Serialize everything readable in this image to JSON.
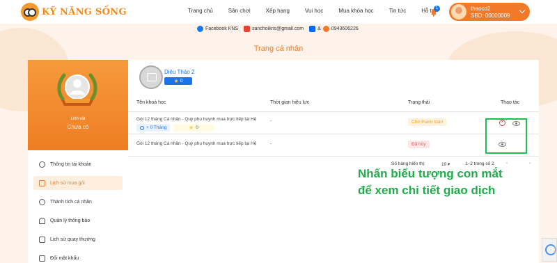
{
  "header": {
    "logo_text": "KỸ NĂNG SỐNG",
    "nav": [
      "Trang chủ",
      "Sân chơi",
      "Xếp hạng",
      "Vui học",
      "Mua khóa học",
      "Tin tức",
      "Hỗ trợ"
    ],
    "notification_count": "1",
    "user": {
      "name": "thaocd2",
      "sbd": "SBD: 00000009"
    }
  },
  "contacts": {
    "facebook": "Facebook KNS",
    "email": "sanchoikns@gmail.com",
    "amp": "&",
    "phone": "0943606226"
  },
  "page_title": "Trang cá nhân",
  "sidebar": {
    "rank_label": "Linh vật",
    "rank_value": "Chưa có",
    "menu": [
      {
        "label": "Thông tin tài khoản",
        "icon": "user-icon",
        "active": false
      },
      {
        "label": "Lịch sử mua gói",
        "icon": "cart-icon",
        "active": true
      },
      {
        "label": "Thành tích cá nhân",
        "icon": "medal-icon",
        "active": false
      },
      {
        "label": "Quản lý thông báo",
        "icon": "bell-icon",
        "active": false
      },
      {
        "label": "Lịch sử quay thưởng",
        "icon": "history-icon",
        "active": false
      },
      {
        "label": "Đổi mật khẩu",
        "icon": "lock-icon",
        "active": false
      }
    ]
  },
  "profile": {
    "name": "Diệu Thảo 2",
    "stars": "0"
  },
  "table": {
    "headers": [
      "Tên khoá học",
      "Thời gian hiệu lực",
      "Trạng thái",
      "Thao tác"
    ],
    "rows": [
      {
        "name": "Gói 12 tháng Cá nhân - Quý phụ huynh mua trực tiếp tại Hệ",
        "validity": "-",
        "status": "Chờ thanh toán",
        "months": "+ 0 Tháng",
        "stars": "0"
      },
      {
        "name": "Gói 12 tháng Cá nhân - Quý phụ huynh mua trực tiếp tại Hệ",
        "validity": "-",
        "status": "Đã hủy"
      }
    ]
  },
  "pagination": {
    "rows_label": "Số hàng hiển thị:",
    "rows_value": "10",
    "range": "1–2 trong số 2"
  },
  "annotation": {
    "line1": "Nhấn biểu tượng con mắt",
    "line2": "để xem chi tiết giao dịch"
  },
  "colors": {
    "accent": "#f07a2a",
    "link": "#1a73e8",
    "annotation": "#1fad4a"
  }
}
